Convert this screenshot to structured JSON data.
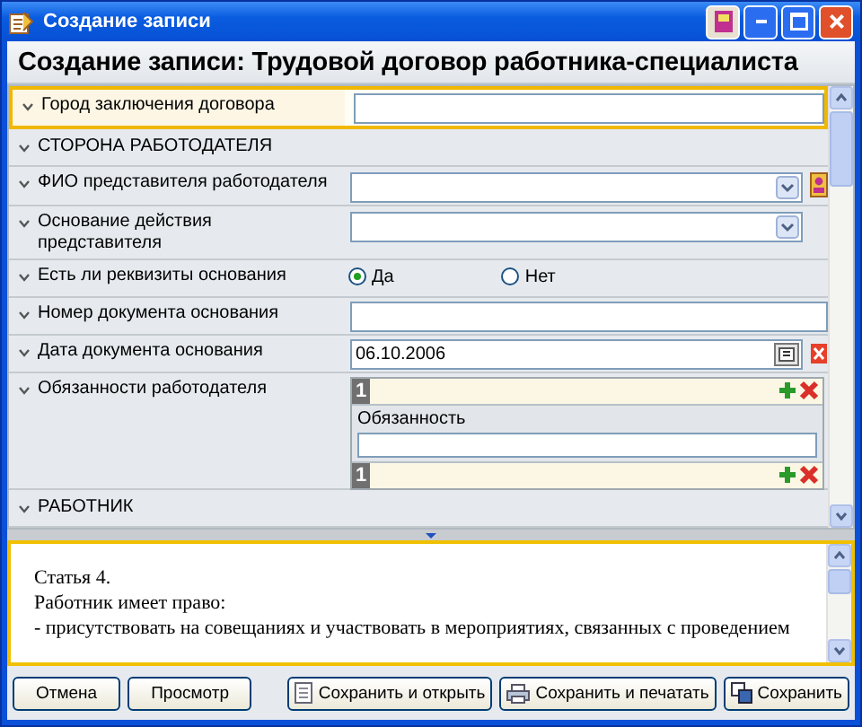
{
  "window": {
    "title": "Создание записи"
  },
  "heading": "Создание записи: Трудовой договор работника-специалиста",
  "form": {
    "rows": [
      {
        "kind": "text",
        "label": "Город заключения договора",
        "focused": true,
        "value": ""
      },
      {
        "kind": "section",
        "label": "СТОРОНА РАБОТОДАТЕЛЯ",
        "focused": false
      },
      {
        "kind": "dropdown",
        "label": "ФИО представителя работодателя",
        "focused": false,
        "picker": true
      },
      {
        "kind": "dropdown",
        "label": "Основание действия представителя",
        "focused": false,
        "picker": false
      },
      {
        "kind": "radio",
        "label": "Есть ли реквизиты основания",
        "focused": false,
        "options": [
          {
            "label": "Да",
            "selected": true
          },
          {
            "label": "Нет",
            "selected": false
          }
        ]
      },
      {
        "kind": "text",
        "label": "Номер документа основания",
        "focused": false,
        "value": ""
      },
      {
        "kind": "date",
        "label": "Дата документа основания",
        "focused": false,
        "value": "06.10.2006"
      },
      {
        "kind": "repeater",
        "label": "Обязанности работодателя",
        "focused": false,
        "index": "1",
        "field_label": "Обязанность",
        "footer_index": "1"
      },
      {
        "kind": "section",
        "label": "РАБОТНИК",
        "focused": false
      }
    ]
  },
  "document": {
    "lines": [
      {
        "text": "Статья 4."
      },
      {
        "text": "Работник имеет право:"
      },
      {
        "text": "- присутствовать  на совещаниях  и  участвовать в мероприятиях, связанных с проведением"
      }
    ]
  },
  "buttons": [
    {
      "label": "Отмена",
      "kind": "plain"
    },
    {
      "label": "Просмотр",
      "kind": "plain"
    },
    {
      "label": "Сохранить и открыть",
      "kind": "open"
    },
    {
      "label": "Сохранить и печатать",
      "kind": "print"
    },
    {
      "label": "Сохранить",
      "kind": "save"
    }
  ]
}
